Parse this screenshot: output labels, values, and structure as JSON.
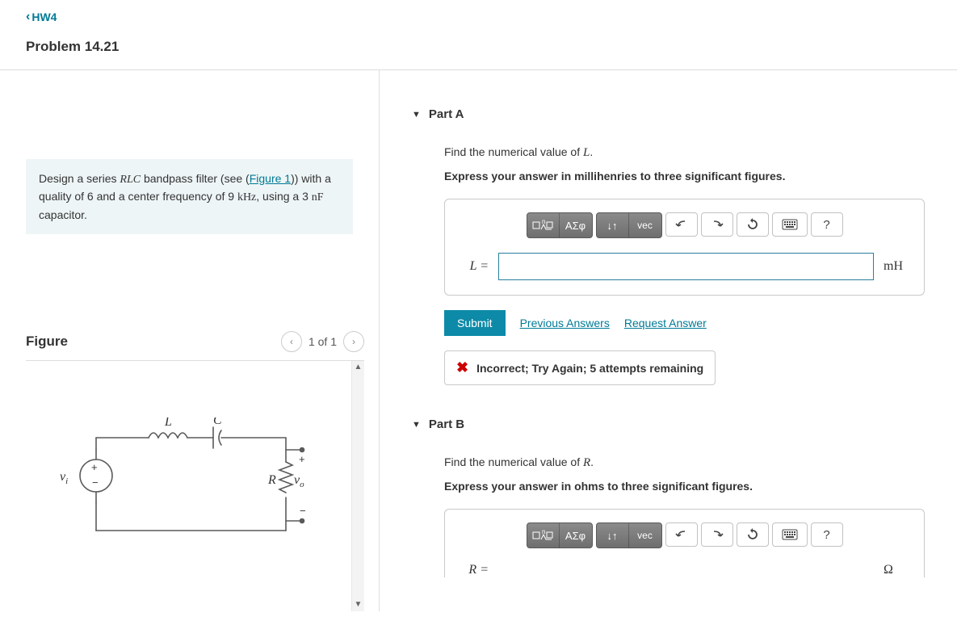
{
  "nav": {
    "back_label": "HW4"
  },
  "problem": {
    "title": "Problem 14.21",
    "prompt_pre": "Design a series ",
    "prompt_rlc": "RLC",
    "prompt_mid1": " bandpass filter (see (",
    "figure_link": "Figure 1",
    "prompt_mid2": ")) with a quality of 6 and a center frequency of 9 ",
    "prompt_unit1": "kHz",
    "prompt_mid3": ", using a 3 ",
    "prompt_unit2": "nF",
    "prompt_end": " capacitor."
  },
  "figure": {
    "label": "Figure",
    "pager": "1 of 1",
    "labels": {
      "L": "L",
      "C": "C",
      "R": "R",
      "vi": "v",
      "vi_sub": "i",
      "vo": "v",
      "vo_sub": "o",
      "plus": "+",
      "minus": "−"
    }
  },
  "partA": {
    "label": "Part A",
    "find_pre": "Find the numerical value of ",
    "find_sym": "L",
    "find_post": ".",
    "instr": "Express your answer in millihenries to three significant figures.",
    "lhs": "L =",
    "unit": "mH",
    "submit": "Submit",
    "prev_answers": "Previous Answers",
    "request_answer": "Request Answer",
    "feedback": "Incorrect; Try Again; 5 attempts remaining"
  },
  "partB": {
    "label": "Part B",
    "find_pre": "Find the numerical value of ",
    "find_sym": "R",
    "find_post": ".",
    "instr": "Express your answer in ohms to three significant figures.",
    "lhs": "R =",
    "unit": "Ω"
  },
  "toolbar": {
    "templates": "□√∕□",
    "greek": "ΑΣφ",
    "arrows": "↓↑",
    "vec": "vec",
    "help": "?"
  }
}
